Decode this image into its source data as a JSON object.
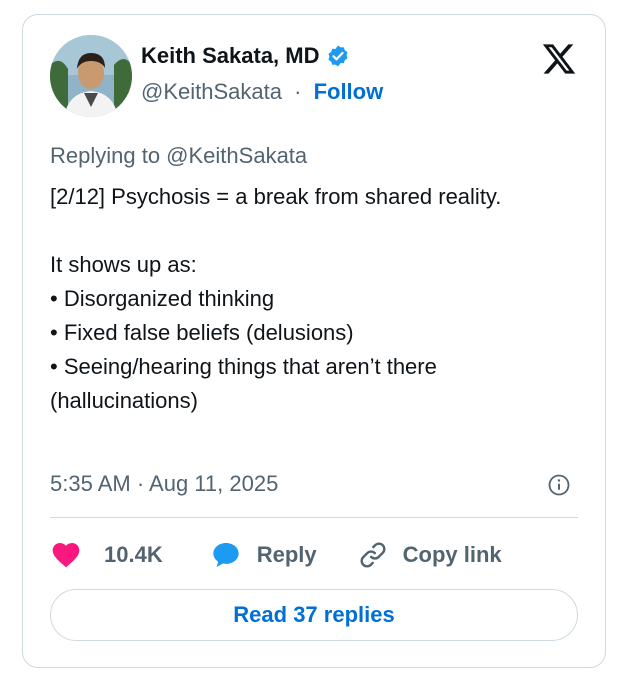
{
  "author": {
    "name": "Keith Sakata, MD",
    "handle": "@KeithSakata",
    "separator": "·",
    "follow_label": "Follow"
  },
  "reply_context": {
    "text": "Replying to @KeithSakata"
  },
  "tweet": {
    "lines": [
      "[2/12] Psychosis = a break from shared reality.",
      "",
      "It shows up as:",
      "• Disorganized thinking",
      "• Fixed false beliefs (delusions)",
      "• Seeing/hearing things that aren’t there (hallucinations)"
    ],
    "timestamp": "5:35 AM · Aug 11, 2025"
  },
  "actions": {
    "like_count": "10.4K",
    "reply_label": "Reply",
    "copy_link_label": "Copy link"
  },
  "read_replies_label": "Read 37 replies",
  "colors": {
    "like": "#f91880",
    "reply": "#1d9bf0",
    "verified": "#1d9bf0",
    "link": "#006fd6",
    "muted": "#536471"
  },
  "icons": {
    "verified": "verified-badge-icon",
    "x_logo": "x-logo-icon",
    "info": "info-icon",
    "like": "heart-icon",
    "reply": "speech-bubble-icon",
    "copy_link": "link-icon"
  }
}
